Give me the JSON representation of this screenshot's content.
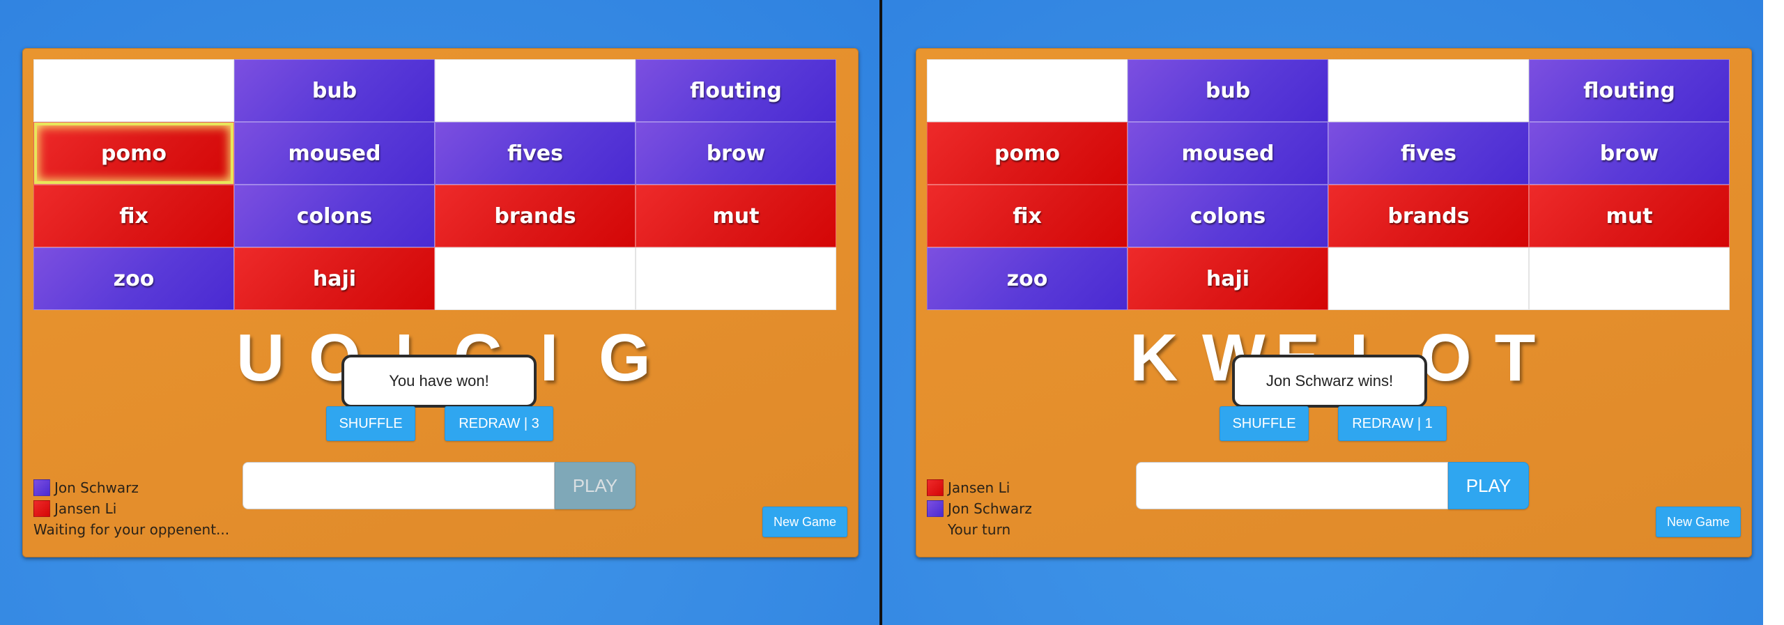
{
  "left_view": {
    "grid": [
      {
        "word": "",
        "color": "empty"
      },
      {
        "word": "bub",
        "color": "blue"
      },
      {
        "word": "",
        "color": "empty"
      },
      {
        "word": "flouting",
        "color": "blue"
      },
      {
        "word": "pomo",
        "color": "red",
        "highlight": true
      },
      {
        "word": "moused",
        "color": "blue"
      },
      {
        "word": "fives",
        "color": "blue"
      },
      {
        "word": "brow",
        "color": "blue"
      },
      {
        "word": "fix",
        "color": "red"
      },
      {
        "word": "colons",
        "color": "blue"
      },
      {
        "word": "brands",
        "color": "red"
      },
      {
        "word": "mut",
        "color": "red"
      },
      {
        "word": "zoo",
        "color": "blue"
      },
      {
        "word": "haji",
        "color": "red"
      },
      {
        "word": "",
        "color": "empty"
      },
      {
        "word": "",
        "color": "empty"
      }
    ],
    "letters": [
      "U",
      "O",
      "I",
      "C",
      "I",
      "G"
    ],
    "toast": "You have won!",
    "shuffle_label": "SHUFFLE",
    "redraw_label": "REDRAW | 3",
    "input_value": "",
    "play_label": "PLAY",
    "play_disabled": true,
    "new_game_label": "New Game",
    "players": [
      {
        "name": "Jon Schwarz",
        "color": "blue"
      },
      {
        "name": "Jansen Li",
        "color": "red"
      }
    ],
    "status": "Waiting for your oppenent..."
  },
  "right_view": {
    "grid": [
      {
        "word": "",
        "color": "empty"
      },
      {
        "word": "bub",
        "color": "blue"
      },
      {
        "word": "",
        "color": "empty"
      },
      {
        "word": "flouting",
        "color": "blue"
      },
      {
        "word": "pomo",
        "color": "red"
      },
      {
        "word": "moused",
        "color": "blue"
      },
      {
        "word": "fives",
        "color": "blue"
      },
      {
        "word": "brow",
        "color": "blue"
      },
      {
        "word": "fix",
        "color": "red"
      },
      {
        "word": "colons",
        "color": "blue"
      },
      {
        "word": "brands",
        "color": "red"
      },
      {
        "word": "mut",
        "color": "red"
      },
      {
        "word": "zoo",
        "color": "blue"
      },
      {
        "word": "haji",
        "color": "red"
      },
      {
        "word": "",
        "color": "empty"
      },
      {
        "word": "",
        "color": "empty"
      }
    ],
    "letters": [
      "K",
      "W",
      "E",
      "L",
      "O",
      "T"
    ],
    "toast": "Jon Schwarz wins!",
    "shuffle_label": "SHUFFLE",
    "redraw_label": "REDRAW | 1",
    "input_value": "",
    "play_label": "PLAY",
    "play_disabled": false,
    "new_game_label": "New Game",
    "players": [
      {
        "name": "Jansen Li",
        "color": "red"
      },
      {
        "name": "Jon Schwarz",
        "color": "blue"
      }
    ],
    "status": "Your turn"
  },
  "colors": {
    "background": "#3a8ee5",
    "board": "#e48e2c",
    "tile_blue": "#5a3ad8",
    "tile_red": "#dc1616",
    "button": "#2fa6f0",
    "button_disabled": "#7fa8b8",
    "highlight": "#e8e65a"
  }
}
